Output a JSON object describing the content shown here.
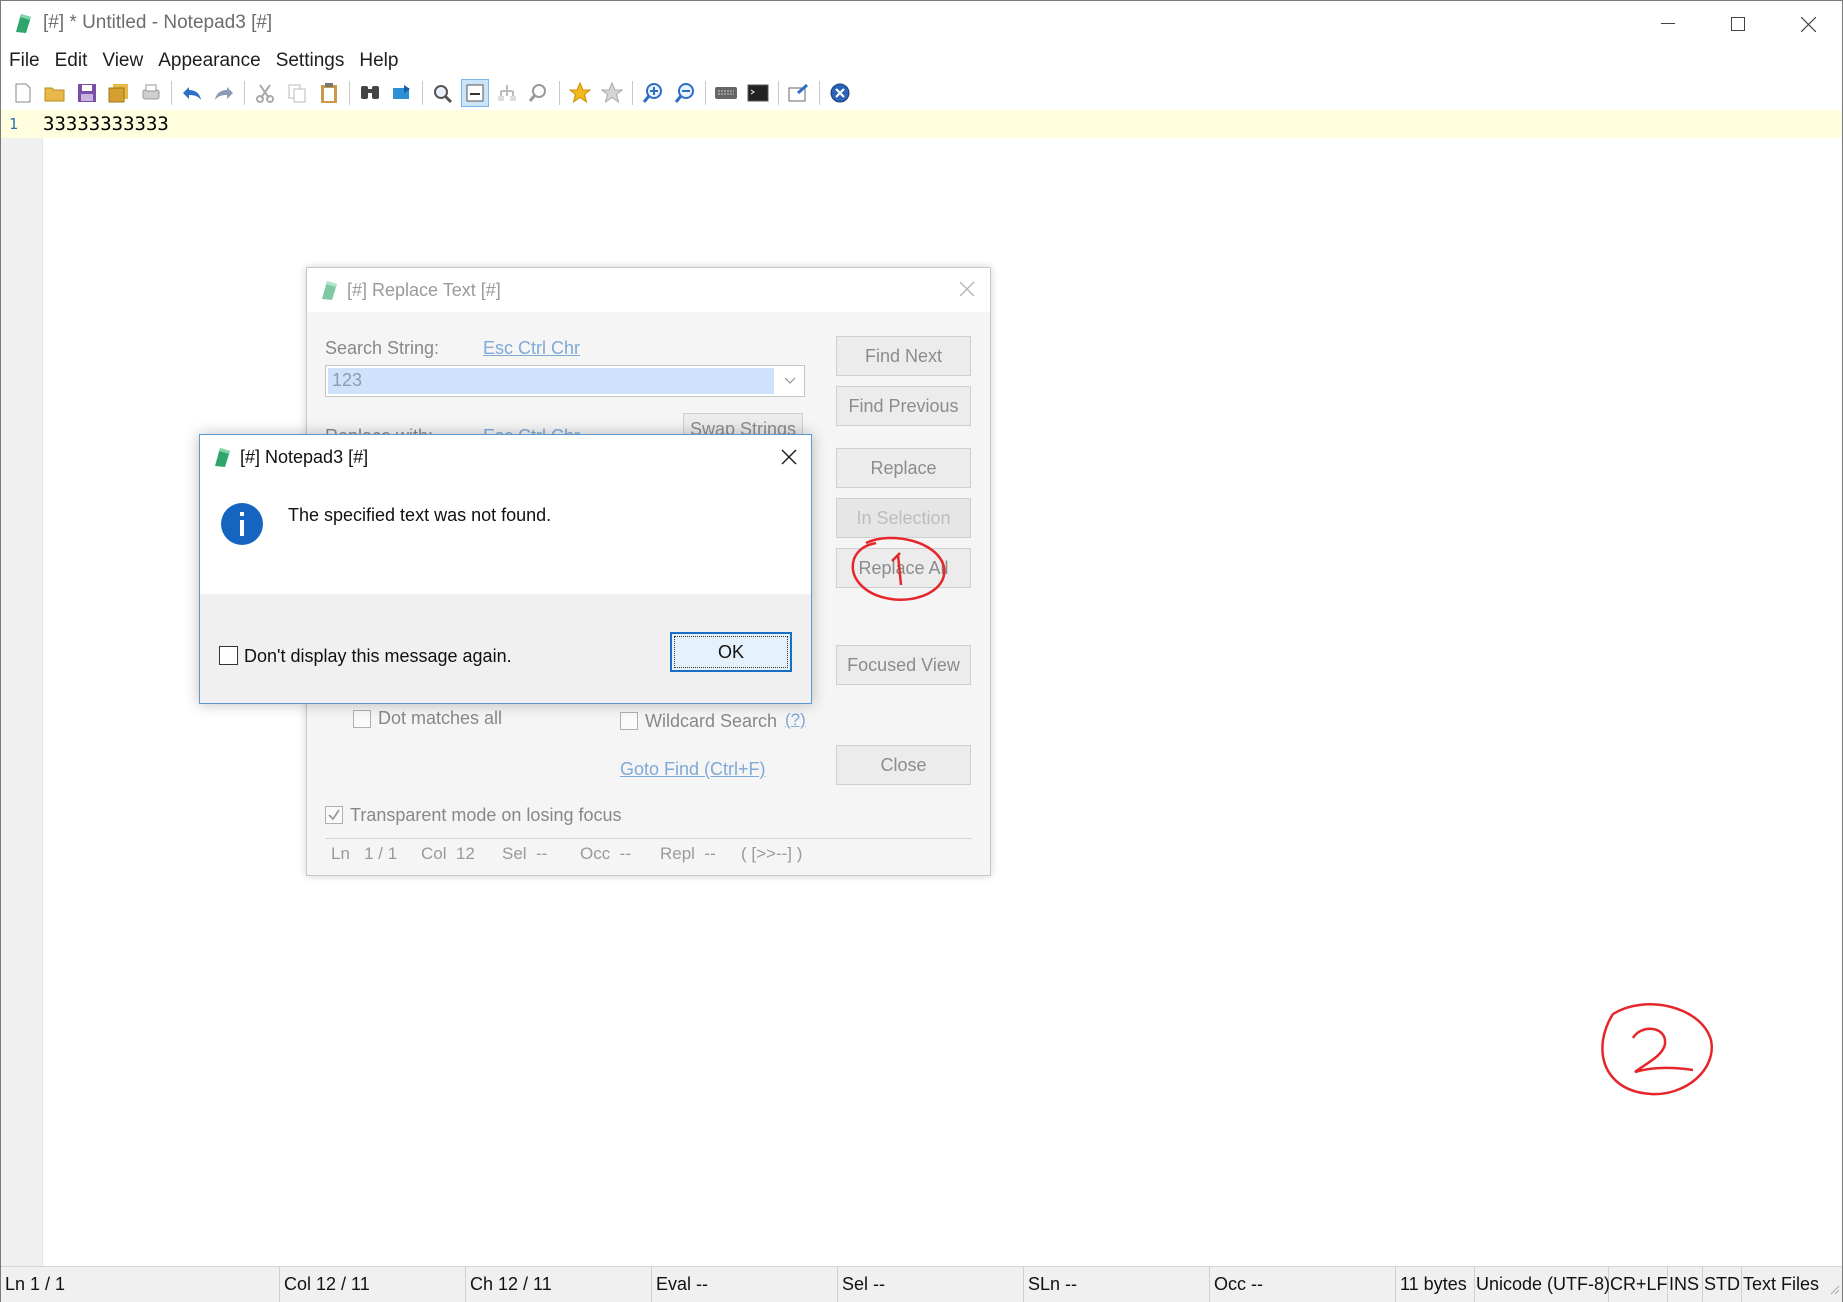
{
  "app": {
    "title": "[#] * Untitled - Notepad3 [#]"
  },
  "menu": [
    "File",
    "Edit",
    "View",
    "Appearance",
    "Settings",
    "Help"
  ],
  "toolbar": {
    "icons": [
      "new-file-icon",
      "open-folder-icon",
      "save-icon",
      "save-as-icon",
      "print-icon",
      "undo-icon",
      "redo-icon",
      "cut-icon",
      "copy-icon",
      "paste-icon",
      "find-icon",
      "replace-icon",
      "find-next-icon",
      "word-wrap-icon",
      "goto-icon",
      "zoom-find-icon",
      "favorite-star-icon",
      "add-favorite-icon",
      "zoom-in-icon",
      "zoom-out-icon",
      "keyboard-icon",
      "terminal-icon",
      "pin-icon",
      "exit-icon"
    ]
  },
  "editor": {
    "line_number": "1",
    "line_text": "33333333333"
  },
  "statusbar": {
    "ln": "Ln  1 / 1",
    "col": "Col  12 / 11",
    "ch": "Ch  12 / 11",
    "eval": "Eval  --",
    "sel": "Sel  --",
    "sln": "SLn  --",
    "occ": "Occ  --",
    "bytes": "11 bytes",
    "encoding": "Unicode (UTF-8)",
    "eol": "CR+LF",
    "ins": "INS",
    "std": "STD",
    "filetype": "Text Files"
  },
  "replace_dialog": {
    "title": "[#] Replace Text [#]",
    "search_label": "Search String:",
    "search_link": "Esc Ctrl Chr",
    "search_value": "123",
    "replace_label": "Replace with:",
    "replace_link": "Esc Ctrl Chr",
    "swap_button": "Swap Strings",
    "find_next": "Find Next",
    "find_previous": "Find Previous",
    "replace": "Replace",
    "in_selection": "In Selection",
    "replace_all": "Replace All",
    "focused_view": "Focused View",
    "close": "Close",
    "dot_matches": "Dot matches all",
    "wildcard": "Wildcard Search",
    "wildcard_help": "(?)",
    "goto_find": "Goto Find (Ctrl+F)",
    "transparent": "Transparent mode on losing focus",
    "status": {
      "ln": "Ln   1 / 1",
      "col": "Col  12",
      "sel": "Sel  --",
      "occ": "Occ  --",
      "repl": "Repl  --",
      "arrows": "( [>>--] )"
    }
  },
  "message_box": {
    "title": "[#] Notepad3 [#]",
    "message": "The specified text was not found.",
    "checkbox_label": "Don't display this message again.",
    "ok": "OK"
  },
  "annotations": {
    "color": "#e5262b"
  }
}
